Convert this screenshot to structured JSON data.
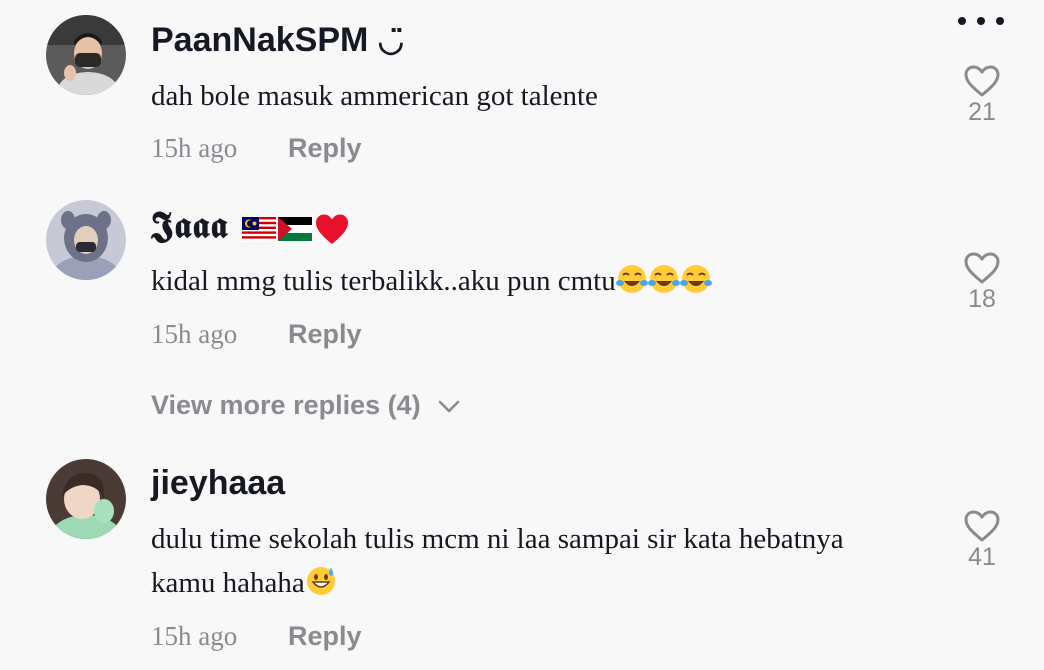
{
  "comments": [
    {
      "username": "PaanNakSPM",
      "username_suffix": "◡̈",
      "text": "dah bole masuk ammerican got talente",
      "time": "15h ago",
      "reply_label": "Reply",
      "like_count": "21"
    },
    {
      "username": "𝕵𝖆𝖆𝖆",
      "username_emoji": [
        "malaysia-flag",
        "palestine-flag",
        "red-heart"
      ],
      "text": "kidal mmg tulis terbalikk..aku pun cmtu",
      "text_emoji": [
        "tears-of-joy",
        "tears-of-joy",
        "tears-of-joy"
      ],
      "time": "15h ago",
      "reply_label": "Reply",
      "like_count": "18",
      "view_more_label": "View more replies (4)"
    },
    {
      "username": "jieyhaaa",
      "text_line1": "dulu time sekolah tulis mcm ni laa sampai sir kata hebatnya",
      "text_line2": "kamu hahaha",
      "text_emoji": [
        "grinning-sweat"
      ],
      "time": "15h ago",
      "reply_label": "Reply",
      "like_count": "41"
    }
  ],
  "icons": {
    "like": "heart-outline-icon",
    "more": "more-horizontal-icon",
    "chevron": "chevron-down-icon"
  },
  "colors": {
    "background": "#f8f8f8",
    "primary_text": "#161823",
    "secondary_text": "#8a8b91"
  }
}
